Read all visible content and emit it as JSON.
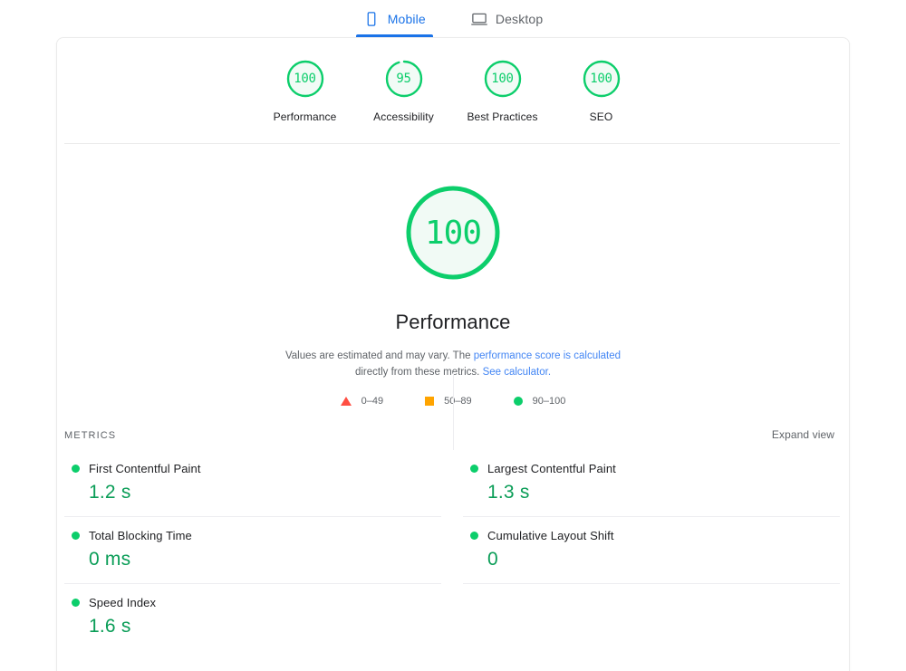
{
  "tabs": [
    {
      "label": "Mobile",
      "icon": "mobile-phone-icon",
      "active": true
    },
    {
      "label": "Desktop",
      "icon": "desktop-monitor-icon",
      "active": false
    }
  ],
  "category_scores": [
    {
      "label": "Performance",
      "score": "100",
      "value": 100
    },
    {
      "label": "Accessibility",
      "score": "95",
      "value": 95
    },
    {
      "label": "Best Practices",
      "score": "100",
      "value": 100
    },
    {
      "label": "SEO",
      "score": "100",
      "value": 100
    }
  ],
  "hero": {
    "score": "100",
    "value": 100,
    "title": "Performance",
    "desc_part1": "Values are estimated and may vary. The ",
    "desc_link1": "performance score is calculated",
    "desc_part2": " directly from these metrics. ",
    "desc_link2": "See calculator."
  },
  "legend": [
    {
      "shape": "triangle",
      "range": "0–49",
      "color": "#ff4e42"
    },
    {
      "shape": "square",
      "range": "50–89",
      "color": "#ffa400"
    },
    {
      "shape": "circle",
      "range": "90–100",
      "color": "#0cce6b"
    }
  ],
  "metrics_section": {
    "title": "METRICS",
    "expand_label": "Expand view"
  },
  "metrics": [
    {
      "name": "First Contentful Paint",
      "value": "1.2 s",
      "status": "good"
    },
    {
      "name": "Largest Contentful Paint",
      "value": "1.3 s",
      "status": "good"
    },
    {
      "name": "Total Blocking Time",
      "value": "0 ms",
      "status": "good"
    },
    {
      "name": "Cumulative Layout Shift",
      "value": "0",
      "status": "good"
    },
    {
      "name": "Speed Index",
      "value": "1.6 s",
      "status": "good"
    }
  ],
  "colors": {
    "good": "#0cce6b",
    "average": "#ffa400",
    "poor": "#ff4e42",
    "accent": "#1a73e8",
    "link": "#4285f4",
    "value_text": "#0a9d57"
  }
}
